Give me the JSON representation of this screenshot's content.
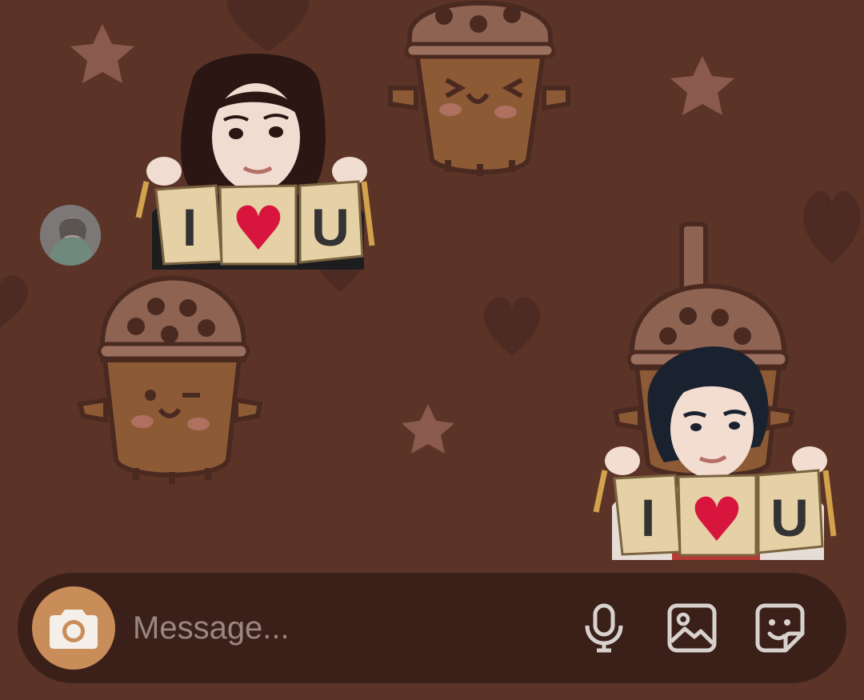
{
  "composer": {
    "placeholder": "Message...",
    "camera_icon": "camera-icon",
    "mic_icon": "microphone-icon",
    "gallery_icon": "gallery-icon",
    "sticker_icon": "sticker-icon"
  },
  "stickers": {
    "left": {
      "banner": [
        "I",
        "♥",
        "U"
      ]
    },
    "right": {
      "banner": [
        "I",
        "♥",
        "U"
      ]
    }
  },
  "colors": {
    "background": "#5c3427",
    "composer": "#3b2019",
    "camera_button": "#c98d59",
    "heart": "#d8163d"
  }
}
